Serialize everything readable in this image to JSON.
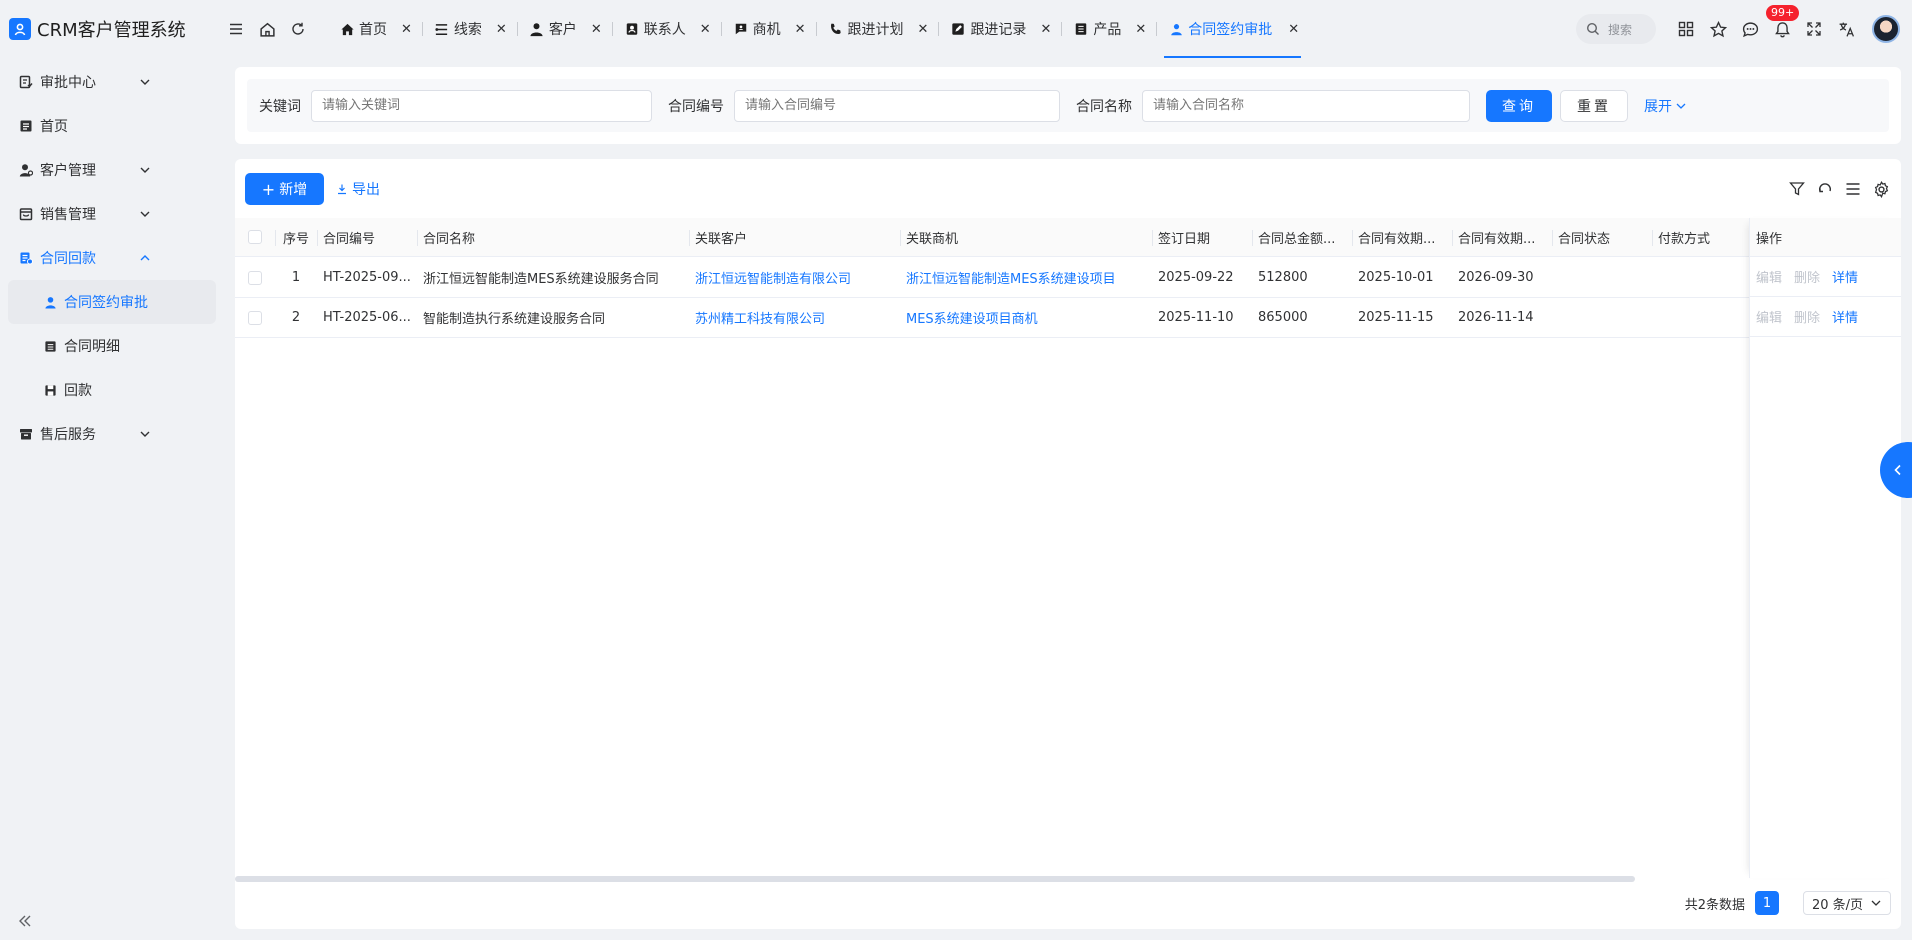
{
  "app": {
    "title": "CRM客户管理系统",
    "accent": "#1677ff"
  },
  "sidebar": {
    "items": [
      {
        "label": "审批中心",
        "icon": "approval-icon",
        "expandable": true,
        "open": false
      },
      {
        "label": "首页",
        "icon": "home-doc-icon",
        "expandable": false
      },
      {
        "label": "客户管理",
        "icon": "customer-icon",
        "expandable": true,
        "open": false
      },
      {
        "label": "销售管理",
        "icon": "sales-icon",
        "expandable": true,
        "open": false
      },
      {
        "label": "合同回款",
        "icon": "contract-icon",
        "expandable": true,
        "open": true
      }
    ],
    "contract_children": [
      {
        "label": "合同签约审批",
        "icon": "user-icon",
        "active": true
      },
      {
        "label": "合同明细",
        "icon": "list-icon",
        "active": false
      },
      {
        "label": "回款",
        "icon": "save-icon",
        "active": false
      }
    ],
    "after_items": [
      {
        "label": "售后服务",
        "icon": "service-icon",
        "expandable": true
      }
    ]
  },
  "tabs": [
    {
      "label": "首页",
      "icon": "home-icon",
      "active": false
    },
    {
      "label": "线索",
      "icon": "lead-icon",
      "active": false
    },
    {
      "label": "客户",
      "icon": "person-icon",
      "active": false
    },
    {
      "label": "联系人",
      "icon": "contact-icon",
      "active": false
    },
    {
      "label": "商机",
      "icon": "opportunity-icon",
      "active": false
    },
    {
      "label": "跟进计划",
      "icon": "phone-icon",
      "active": false
    },
    {
      "label": "跟进记录",
      "icon": "edit-icon",
      "active": false
    },
    {
      "label": "产品",
      "icon": "product-icon",
      "active": false
    },
    {
      "label": "合同签约审批",
      "icon": "user-icon",
      "active": true
    }
  ],
  "header": {
    "search_label": "搜索",
    "notification_badge": "99+"
  },
  "filter": {
    "keyword_label": "关键词",
    "keyword_placeholder": "请输入关键词",
    "contract_no_label": "合同编号",
    "contract_no_placeholder": "请输入合同编号",
    "contract_name_label": "合同名称",
    "contract_name_placeholder": "请输入合同名称",
    "query_label": "查询",
    "reset_label": "重置",
    "expand_label": "展开"
  },
  "toolbar": {
    "add_label": "新增",
    "export_label": "导出"
  },
  "table": {
    "columns": [
      "序号",
      "合同编号",
      "合同名称",
      "关联客户",
      "关联商机",
      "签订日期",
      "合同总金额...",
      "合同有效期...",
      "合同有效期...",
      "合同状态",
      "付款方式"
    ],
    "op_header": "操作",
    "rows": [
      {
        "index": "1",
        "contract_no": "HT-2025-09...",
        "contract_name": "浙江恒远智能制造MES系统建设服务合同",
        "customer": "浙江恒远智能制造有限公司",
        "opportunity": "浙江恒远智能制造MES系统建设项目",
        "sign_date": "2025-09-22",
        "amount": "512800",
        "valid_from": "2025-10-01",
        "valid_to": "2026-09-30",
        "status": "",
        "payment": ""
      },
      {
        "index": "2",
        "contract_no": "HT-2025-06...",
        "contract_name": "智能制造执行系统建设服务合同",
        "customer": "苏州精工科技有限公司",
        "opportunity": "MES系统建设项目商机",
        "sign_date": "2025-11-10",
        "amount": "865000",
        "valid_from": "2025-11-15",
        "valid_to": "2026-11-14",
        "status": "",
        "payment": ""
      }
    ],
    "op_edit": "编辑",
    "op_delete": "删除",
    "op_detail": "详情"
  },
  "pager": {
    "total_text": "共2条数据",
    "current_page": "1",
    "page_size": "20 条/页"
  }
}
